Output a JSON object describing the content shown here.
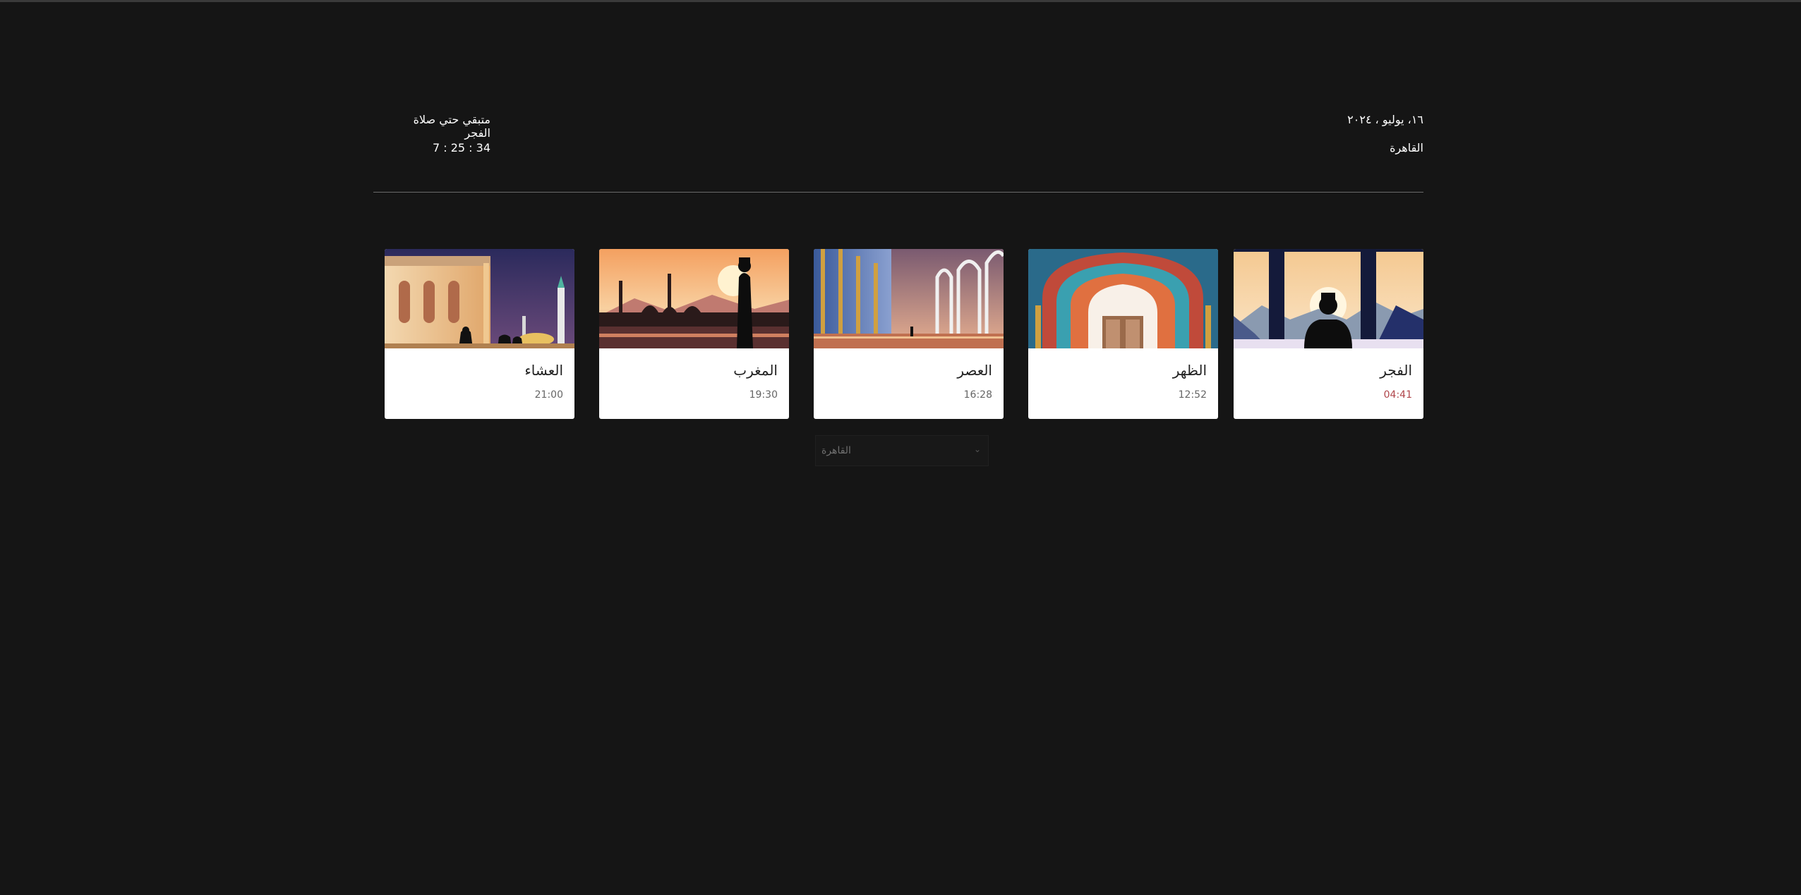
{
  "header": {
    "date": "١٦، يوليو ، ٢٠٢٤",
    "city": "القاهرة",
    "remaining_label": "متبقي حتي صلاة الفجر",
    "countdown": "7 : 25 : 34"
  },
  "prayers": [
    {
      "name": "الفجر",
      "time": "04:41",
      "image": "fajr-silhouette-mountains"
    },
    {
      "name": "الظهر",
      "time": "12:52",
      "image": "dhuhr-ornate-arch"
    },
    {
      "name": "العصر",
      "time": "16:28",
      "image": "asr-colonnade"
    },
    {
      "name": "المغرب",
      "time": "19:30",
      "image": "maghrib-mosque-sunset"
    },
    {
      "name": "العشاء",
      "time": "21:00",
      "image": "isha-mosque-night"
    }
  ],
  "city_select": {
    "selected": "القاهرة",
    "icon": "chevron-down-icon"
  },
  "colors": {
    "background": "#151515",
    "card": "#ffffff",
    "next_time": "#b0454a"
  }
}
